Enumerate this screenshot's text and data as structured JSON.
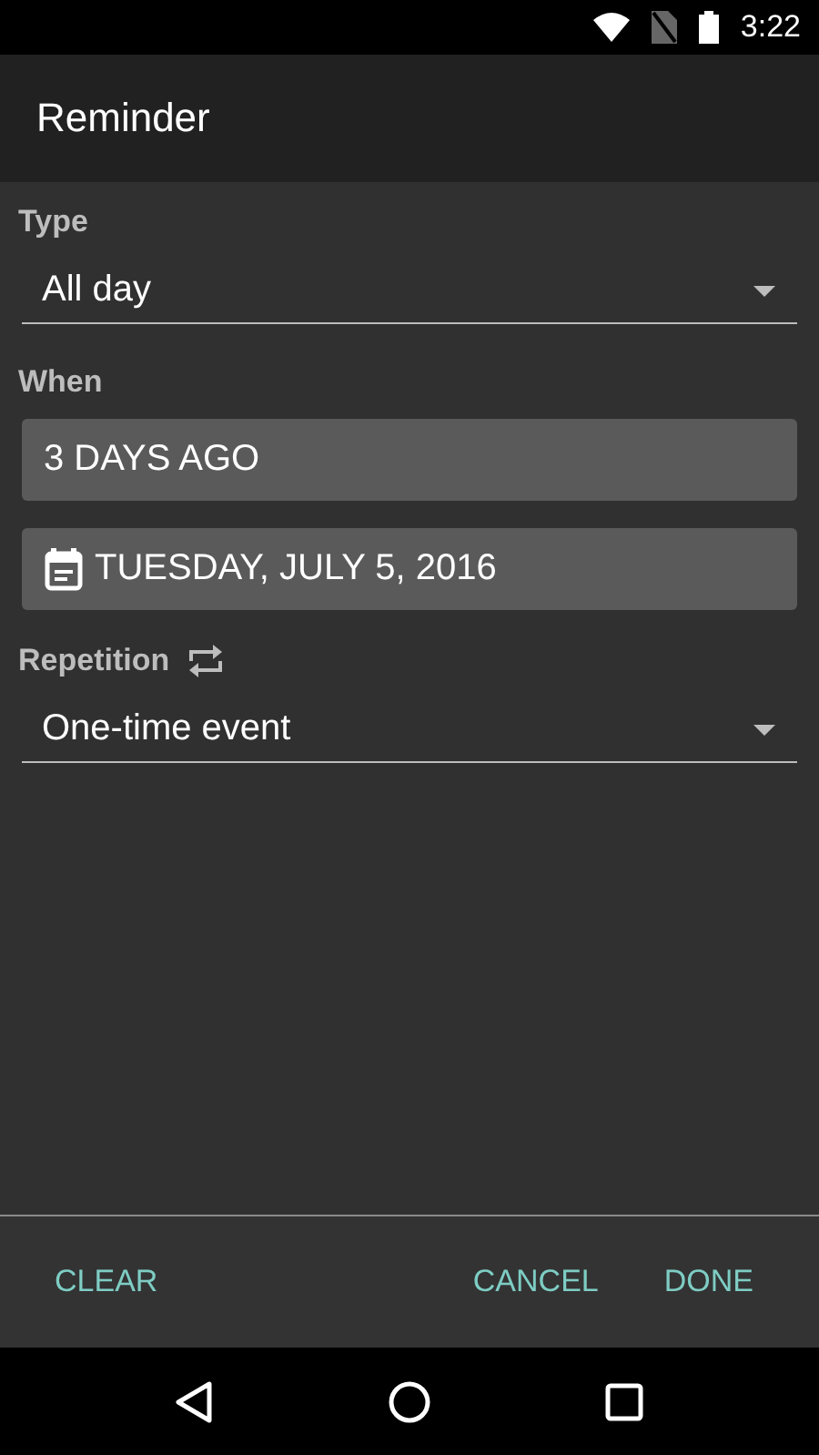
{
  "status_bar": {
    "time": "3:22"
  },
  "app_bar": {
    "title": "Reminder"
  },
  "type": {
    "label": "Type",
    "value": "All day"
  },
  "when": {
    "label": "When",
    "relative": "3 DAYS AGO",
    "date": "TUESDAY, JULY 5, 2016"
  },
  "repetition": {
    "label": "Repetition",
    "value": "One-time event"
  },
  "actions": {
    "left": [
      "CLEAR"
    ],
    "right": [
      "CANCEL",
      "DONE"
    ]
  }
}
